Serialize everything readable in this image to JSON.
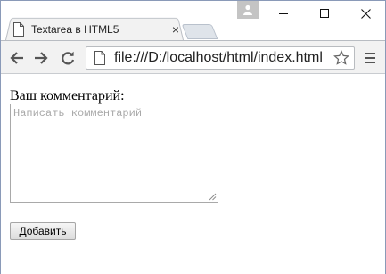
{
  "browser": {
    "tab_title": "Textarea в HTML5",
    "tab_close": "×",
    "url": "file:///D:/localhost/html/index.html"
  },
  "page": {
    "label": "Ваш комментарий:",
    "textarea_value": "",
    "textarea_placeholder": "Написать комментарий",
    "submit_label": "Добавить"
  },
  "icons": {
    "tab": "document-icon",
    "profile": "user-icon",
    "minimize": "minimize-icon",
    "maximize": "maximize-icon",
    "close": "close-icon",
    "back": "arrow-left-icon",
    "forward": "arrow-right-icon",
    "reload": "reload-icon",
    "page": "page-icon",
    "bookmark": "star-icon",
    "menu": "hamburger-icon"
  },
  "colors": {
    "tab_bg": "#f2f2f2",
    "toolbar_bg": "#f2f2f2",
    "window_border": "#8a9ab8"
  }
}
